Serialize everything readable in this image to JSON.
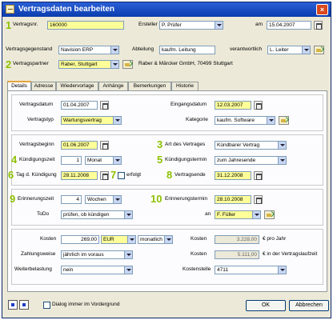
{
  "window": {
    "title": "Vertragsdaten bearbeiten",
    "close_glyph": "×"
  },
  "header": {
    "vertragsnr_label": "Vertragsnr.",
    "vertragsnr_value": "160000",
    "ersteller_label": "Ersteller",
    "ersteller_value": "P. Prüfer",
    "am_label": "am",
    "am_value": "15.04.2007",
    "gegenstand_label": "Vertragsgegenstand",
    "gegenstand_value": "Navision ERP",
    "abteilung_label": "Abteilung",
    "abteilung_value": "kaufm. Leitung",
    "verantwortlich_label": "verantwortlich",
    "verantwortlich_value": "L. Leiter",
    "partner_label": "Vertragspartner",
    "partner_value": "Raber, Stuttgart",
    "partner_info": "Raber & Märcker GmbH, 70499 Stuttgart"
  },
  "tabs": [
    "Details",
    "Adresse",
    "Wiedervorlage",
    "Anhänge",
    "Bemerkungen",
    "Historie"
  ],
  "details": {
    "vertragsdatum_label": "Vertragsdatum",
    "vertragsdatum_value": "01.04.2007",
    "eingangsdatum_label": "Eingangsdatum",
    "eingangsdatum_value": "12.03.2007",
    "vertragstyp_label": "Vertragstyp",
    "vertragstyp_value": "Wartungsvertrag",
    "kategorie_label": "Kategorie",
    "kategorie_value": "kaufm. Software",
    "vertragsbeginn_label": "Vertragsbeginn",
    "vertragsbeginn_value": "01.06.2007",
    "art_label": "Art des Vertrages",
    "art_value": "Kündbarer Vertrag",
    "kuendigungszeit_label": "Kündigungszeit",
    "kuendigungszeit_value": "1",
    "kuendigungszeit_unit": "Monat",
    "kuendigungstermin_label": "Kündigungstermin",
    "kuendigungstermin_value": "zum Jahresende",
    "tag_kuendigung_label": "Tag d. Kündigung",
    "tag_kuendigung_value": "28.11.2008",
    "erfolgt_label": "erfolgt",
    "vertragsende_label": "Vertragsende",
    "vertragsende_value": "31.12.2008",
    "erinnerungszeit_label": "Erinnerungszeit",
    "erinnerungszeit_value": "4",
    "erinnerungszeit_unit": "Wochen",
    "erinnerungstermin_label": "Erinnerungstermin",
    "erinnerungstermin_value": "28.10.2008",
    "todo_label": "ToDo",
    "todo_value": "prüfen, ob kündigen",
    "an_label": "an",
    "an_value": "F. Füller",
    "kosten_label": "Kosten",
    "kosten_value": "269,00",
    "waehrung": "EUR",
    "intervall": "monatlich",
    "kosten2_label": "Kosten",
    "kosten2_value": "3.228,00",
    "kosten2_suffix": "€ pro Jahr",
    "zahlungsweise_label": "Zahlungsweise",
    "zahlungsweise_value": "jährlich im voraus",
    "kosten3_label": "Kosten",
    "kosten3_value": "5.111,00",
    "kosten3_suffix": "€ in der Vertragslaufzeit",
    "weiterbelastung_label": "Weiterbelastung",
    "weiterbelastung_value": "nein",
    "kostenstelle_label": "Kostenstelle",
    "kostenstelle_value": "4711"
  },
  "markers": [
    "1",
    "2",
    "3",
    "4",
    "5",
    "6",
    "7",
    "8",
    "9",
    "10"
  ],
  "footer": {
    "checkbox_label": "Dialog immer im Vordergrund",
    "ok_label": "OK",
    "cancel_label": "Abbrechen"
  }
}
